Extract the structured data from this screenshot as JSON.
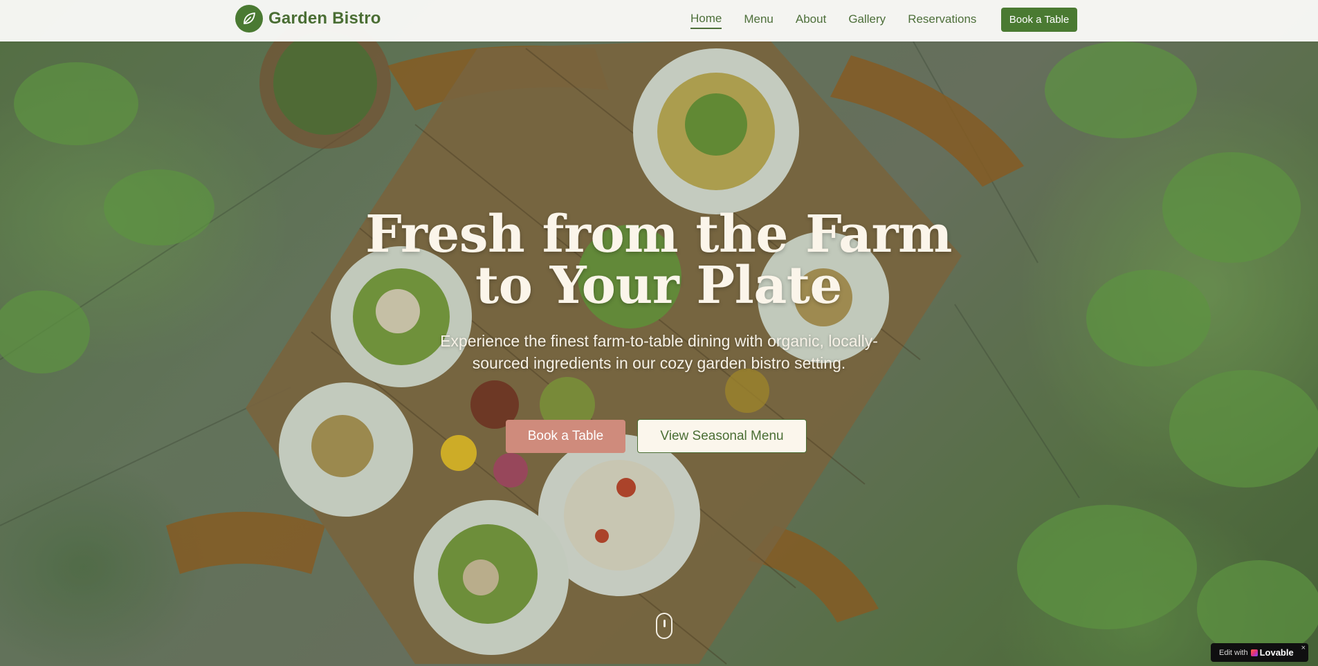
{
  "brand": {
    "name": "Garden Bistro",
    "logo_icon": "leaf-icon"
  },
  "nav": {
    "items": [
      {
        "label": "Home",
        "active": true
      },
      {
        "label": "Menu",
        "active": false
      },
      {
        "label": "About",
        "active": false
      },
      {
        "label": "Gallery",
        "active": false
      },
      {
        "label": "Reservations",
        "active": false
      }
    ],
    "cta_label": "Book a Table"
  },
  "hero": {
    "title_line1": "Fresh from the Farm",
    "title_line2": "to Your Plate",
    "subtitle": "Experience the finest farm-to-table dining with organic, locally-sourced ingredients in our cozy garden bistro setting.",
    "primary_cta": "Book a Table",
    "secondary_cta": "View Seasonal Menu",
    "scroll_icon": "mouse-scroll-icon"
  },
  "badge": {
    "prefix": "Edit with",
    "brand": "Lovable",
    "close": "×"
  },
  "colors": {
    "brand_green": "#4a7a32",
    "nav_text": "#4d6f3a",
    "primary_button": "#cf8b7c",
    "secondary_button_bg": "#fbf6ec",
    "hero_text": "#fbf5ea"
  }
}
